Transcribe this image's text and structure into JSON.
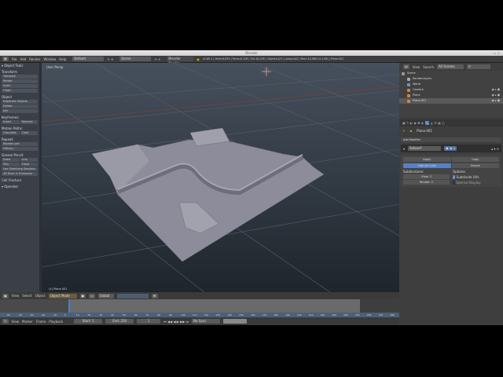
{
  "window": {
    "title": "Blender"
  },
  "menu": {
    "items": [
      "File",
      "Add",
      "Render",
      "Window",
      "Help"
    ],
    "layout": "Default",
    "scene": "Scene",
    "engine": "Blender Render",
    "stats": "v2.69.1 | Verts:8,839 | Faces:8,128 | Tris:16,256 | Objects:0/3 | Lamps:0/0 | Mem:10.88M (0.12M) | Plane.001"
  },
  "toolshelf": {
    "title": "Object Tools",
    "sections": [
      {
        "title": "Transform",
        "buttons": [
          [
            "Translate"
          ],
          [
            "Rotate"
          ],
          [
            "Scale"
          ],
          [
            "Origin"
          ]
        ]
      },
      {
        "title": "Object",
        "buttons": [
          [
            "Duplicate Objects"
          ],
          [
            "Delete"
          ],
          [
            "Join"
          ]
        ]
      },
      {
        "title": "Keyframes:",
        "buttons": [
          [
            "Insert",
            "Remove"
          ]
        ]
      },
      {
        "title": "Motion Paths:",
        "buttons": [
          [
            "Calculate",
            "Clear"
          ]
        ]
      },
      {
        "title": "Repeat:",
        "buttons": [
          [
            "Repeat Last"
          ],
          [
            "History..."
          ]
        ]
      },
      {
        "title": "Grease Pencil:",
        "buttons": [
          [
            "Draw",
            "Line"
          ],
          [
            "Poly",
            "Erase"
          ],
          [
            "Use Sketching Sessions"
          ],
          [
            "3D Ruler & Protractor"
          ]
        ]
      },
      {
        "title": "Cell Fracture",
        "buttons": []
      }
    ],
    "operator": "Operator"
  },
  "viewport": {
    "label": "User Persp",
    "object_label": "(1) Plane.001"
  },
  "view_header": {
    "items": [
      "View",
      "Select",
      "Object"
    ],
    "mode": "Object Mode",
    "pivot": "Global"
  },
  "timeline": {
    "ruler": [
      "-50",
      "-40",
      "-30",
      "-20",
      "-10",
      "0",
      "10",
      "20",
      "30",
      "40",
      "50",
      "60",
      "70",
      "80",
      "90",
      "100",
      "110",
      "120",
      "130",
      "140",
      "150",
      "160",
      "170",
      "180",
      "190",
      "200",
      "210",
      "220",
      "230",
      "240",
      "250",
      "260",
      "270",
      "280"
    ],
    "header": {
      "items": [
        "View",
        "Marker",
        "Frame",
        "Playback"
      ],
      "start": "Start: 1",
      "end": "End: 250",
      "current": "1",
      "sync": "No Sync"
    }
  },
  "outliner": {
    "header": {
      "items": [
        "View",
        "Search"
      ],
      "scene_filter": "All Scenes"
    },
    "items": [
      {
        "name": "Scene",
        "color": "#8899aa"
      },
      {
        "name": "RenderLayers",
        "color": "#aaaaaa"
      },
      {
        "name": "World",
        "color": "#6699cc"
      },
      {
        "name": "Camera",
        "color": "#cc8844"
      },
      {
        "name": "Plane",
        "color": "#cc8844"
      },
      {
        "name": "Plane.001",
        "color": "#cc8844"
      }
    ]
  },
  "properties": {
    "object_name": "Plane.001",
    "add_modifier": "Add Modifier",
    "modifier_name": "Subsurf",
    "apply": "Apply",
    "copy": "Copy",
    "catmull": "Catmull-Clark",
    "simple": "Simple",
    "subdivisions": "Subdivisions:",
    "view": "View: 3",
    "render": "Render: 2",
    "options": "Options:",
    "subdivide_uvs": "Subdivide UVs",
    "optimal_display": "Optimal Display"
  }
}
